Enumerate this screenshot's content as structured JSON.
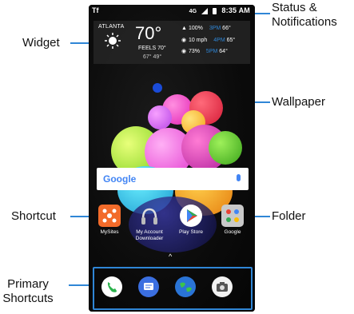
{
  "callouts": {
    "widget": "Widget",
    "status_line1": "Status &",
    "status_line2": "Notifications",
    "wallpaper": "Wallpaper",
    "shortcut": "Shortcut",
    "folder": "Folder",
    "primary_line1": "Primary",
    "primary_line2": "Shortcuts"
  },
  "status_bar": {
    "left": "Tf",
    "network": "4G",
    "time": "8:35 AM"
  },
  "weather_widget": {
    "city": "ATLANTA",
    "temp": "70°",
    "feels": "FEELS 70°",
    "hi_lo": "67° 49°",
    "rows": [
      {
        "icon": "humidity-icon",
        "value": "100%",
        "time": "3PM",
        "temp": "66°"
      },
      {
        "icon": "wind-icon",
        "value": "10 mph",
        "time": "4PM",
        "temp": "65°"
      },
      {
        "icon": "precip-icon",
        "value": "73%",
        "time": "5PM",
        "temp": "64°"
      }
    ]
  },
  "search_bar": {
    "logo": "Google"
  },
  "apps": [
    {
      "label_l1": "MySites",
      "label_l2": ""
    },
    {
      "label_l1": "My Account",
      "label_l2": "Downloader"
    },
    {
      "label_l1": "Play Store",
      "label_l2": ""
    },
    {
      "label_l1": "Google",
      "label_l2": ""
    }
  ],
  "dock": [
    "phone-icon",
    "messages-icon",
    "browser-icon",
    "camera-icon"
  ],
  "colors": {
    "accent": "#2f86d6"
  }
}
